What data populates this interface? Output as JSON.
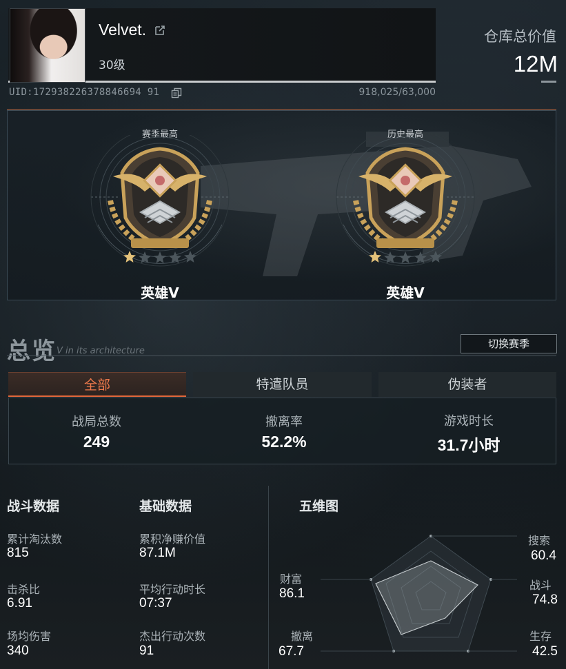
{
  "profile": {
    "username": "Velvet.",
    "level": "30级",
    "uid": "UID:172938226378846694 91",
    "exp": "918,025/63,000"
  },
  "warehouse": {
    "label": "仓库总价值",
    "value": "12M"
  },
  "ranks": [
    {
      "title": "赛季最高",
      "name": "英雄V",
      "stars_filled": 1,
      "stars_total": 5
    },
    {
      "title": "历史最高",
      "name": "英雄V",
      "stars_filled": 1,
      "stars_total": 5
    }
  ],
  "overview": {
    "title": "总览",
    "ghost_text": "V in its architecture",
    "switch_label": "切换赛季",
    "tabs": [
      "全部",
      "特遣队员",
      "伪装者"
    ],
    "active_tab": 0,
    "summary": [
      {
        "label": "战局总数",
        "value": "249"
      },
      {
        "label": "撤离率",
        "value": "52.2%"
      },
      {
        "label": "游戏时长",
        "value": "31.7小时"
      }
    ]
  },
  "combat": {
    "title": "战斗数据",
    "items": [
      {
        "label": "累计淘汰数",
        "value": "815"
      },
      {
        "label": "击杀比",
        "value": "6.91"
      },
      {
        "label": "场均伤害",
        "value": "340"
      }
    ]
  },
  "basic": {
    "title": "基础数据",
    "items": [
      {
        "label": "累积净赚价值",
        "value": "87.1M"
      },
      {
        "label": "平均行动时长",
        "value": "07:37"
      },
      {
        "label": "杰出行动次数",
        "value": "91"
      }
    ]
  },
  "radar": {
    "title": "五维图",
    "axes": [
      {
        "label": "搜索",
        "value": "60.4"
      },
      {
        "label": "战斗",
        "value": "74.8"
      },
      {
        "label": "生存",
        "value": "42.5"
      },
      {
        "label": "撤离",
        "value": "67.7"
      },
      {
        "label": "财富",
        "value": "86.1"
      }
    ]
  },
  "colors": {
    "accent": "#e2673a",
    "panel_border": "#3a4a55",
    "gold": "#c9a25a"
  }
}
